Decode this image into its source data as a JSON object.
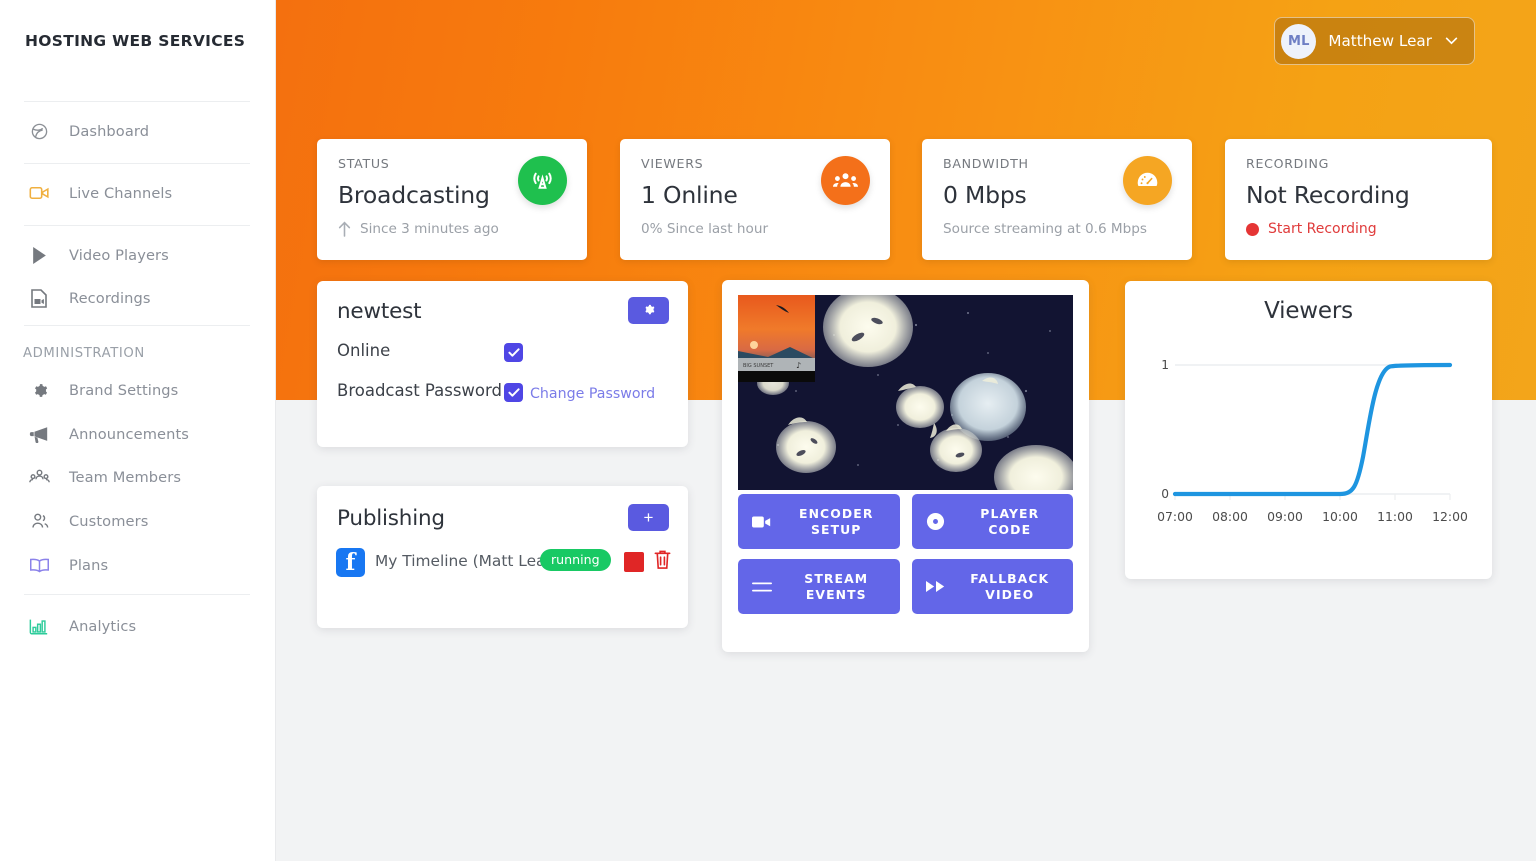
{
  "sidebar": {
    "brand": "HOSTING WEB SERVICES",
    "admin_header": "ADMINISTRATION",
    "items": [
      {
        "label": "Dashboard",
        "icon": "globe-icon"
      },
      {
        "label": "Live Channels",
        "icon": "video-camera-icon"
      },
      {
        "label": "Video Players",
        "icon": "play-icon"
      },
      {
        "label": "Recordings",
        "icon": "file-video-icon"
      },
      {
        "label": "Brand Settings",
        "icon": "gear-icon"
      },
      {
        "label": "Announcements",
        "icon": "megaphone-icon"
      },
      {
        "label": "Team Members",
        "icon": "users-group-icon"
      },
      {
        "label": "Customers",
        "icon": "user-pair-icon"
      },
      {
        "label": "Plans",
        "icon": "book-icon"
      },
      {
        "label": "Analytics",
        "icon": "bar-chart-icon"
      }
    ]
  },
  "header": {
    "title": "NEWTEST",
    "user": {
      "initials": "ML",
      "name": "Matthew Lear",
      "caret": "chevron-down-icon"
    }
  },
  "stats": [
    {
      "kicker": "STATUS",
      "value": "Broadcasting",
      "sub": "Since 3 minutes ago",
      "sub_icon": "arrow-up-icon",
      "badge_icon": "broadcast-tower-icon",
      "badge_color": "#1fc04e"
    },
    {
      "kicker": "VIEWERS",
      "value": "1 Online",
      "sub": "0% Since last hour",
      "sub_icon": "",
      "badge_icon": "users-group-icon",
      "badge_color": "#f4701a"
    },
    {
      "kicker": "BANDWIDTH",
      "value": "0 Mbps",
      "sub": "Source streaming at 0.6 Mbps",
      "sub_icon": "",
      "badge_icon": "gauge-icon",
      "badge_color": "#f5a623"
    },
    {
      "kicker": "RECORDING",
      "value": "Not Recording",
      "sub": "Start Recording",
      "sub_icon": "record-dot-icon",
      "badge_icon": "",
      "badge_color": ""
    }
  ],
  "channel": {
    "name": "newtest",
    "gear_icon": "gear-icon",
    "online_label": "Online",
    "online_checked": true,
    "password_label": "Broadcast Password",
    "password_checked": true,
    "change_password_link": "Change Password"
  },
  "publishing": {
    "title": "Publishing",
    "add_label": "+",
    "destination": "My Timeline (Matt Lear)",
    "destination_icon": "facebook-icon",
    "status": "running",
    "stop_icon": "stop-square-icon",
    "delete_icon": "trash-icon"
  },
  "video": {
    "preview_alt": "jellyfish-stream-preview",
    "buttons": [
      {
        "label": "ENCODER SETUP",
        "line1": "ENCODER",
        "line2": "SETUP",
        "icon": "video-camera-icon"
      },
      {
        "label": "PLAYER CODE",
        "line1": "PLAYER",
        "line2": "CODE",
        "icon": "disc-icon"
      },
      {
        "label": "STREAM EVENTS",
        "line1": "STREAM",
        "line2": "EVENTS",
        "icon": "list-icon"
      },
      {
        "label": "FALLBACK VIDEO",
        "line1": "FALLBACK",
        "line2": "VIDEO",
        "icon": "fast-forward-icon"
      }
    ]
  },
  "chart_data": {
    "type": "line",
    "title": "Viewers",
    "xlabel": "",
    "ylabel": "",
    "x": [
      "07:00",
      "08:00",
      "09:00",
      "10:00",
      "11:00",
      "12:00"
    ],
    "tick_labels": [
      "07:00",
      "08:00",
      "09:00",
      "10:00",
      "11:00",
      "12:00"
    ],
    "y_ticks": [
      "0",
      "1"
    ],
    "ylim": [
      0,
      1
    ],
    "grid": true,
    "legend": false,
    "series": [
      {
        "name": "Viewers",
        "color": "#1e95e0",
        "points": [
          {
            "x": "07:00",
            "y": 0
          },
          {
            "x": "08:00",
            "y": 0
          },
          {
            "x": "09:00",
            "y": 0
          },
          {
            "x": "10:00",
            "y": 0
          },
          {
            "x": "10:30",
            "y": 0.5
          },
          {
            "x": "11:00",
            "y": 1
          },
          {
            "x": "12:00",
            "y": 1
          }
        ]
      }
    ]
  },
  "colors": {
    "accent_orange": "#f5920f",
    "primary_purple": "#5a5ae0",
    "success_green": "#1fc04e",
    "danger_red": "#e02626",
    "chart_blue": "#1e95e0"
  }
}
